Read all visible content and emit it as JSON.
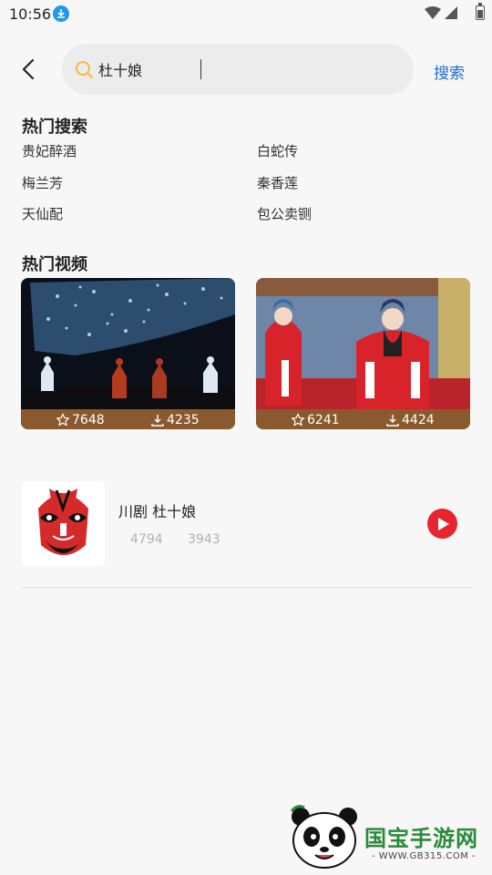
{
  "status_bar": {
    "time": "10:56"
  },
  "search": {
    "query": "杜十娘",
    "button_label": "搜索"
  },
  "hot_search": {
    "title": "热门搜索",
    "items": [
      "贵妃醉酒",
      "白蛇传",
      "梅兰芳",
      "秦香莲",
      "天仙配",
      "包公卖铡"
    ]
  },
  "hot_videos": {
    "title": "热门视频",
    "items": [
      {
        "likes": "7648",
        "downloads": "4235"
      },
      {
        "likes": "6241",
        "downloads": "4424"
      }
    ]
  },
  "results": [
    {
      "title": "川剧 杜十娘",
      "views": "4794",
      "downloads": "3943"
    }
  ],
  "watermark": {
    "brand": "国宝手游网",
    "url": "- WWW.GB315.COM -"
  },
  "colors": {
    "accent": "#1a6ed6",
    "play": "#e8242f",
    "stat_bar": "#8a5a2e",
    "watermark": "#2a8a3a"
  }
}
